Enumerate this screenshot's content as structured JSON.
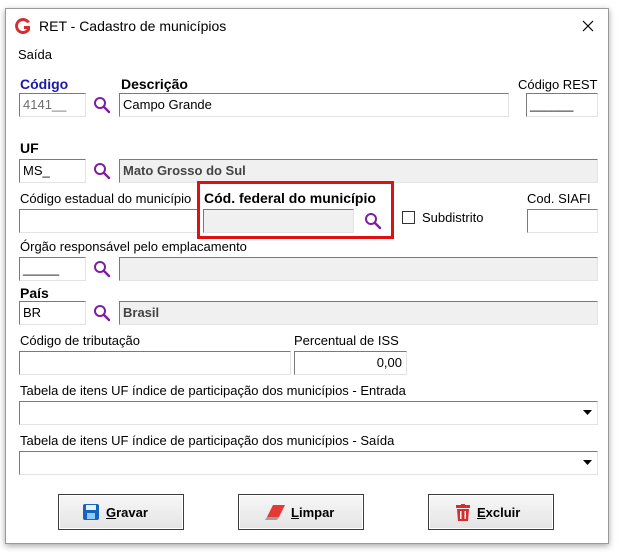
{
  "window": {
    "title": "RET - Cadastro de municípios"
  },
  "menu": {
    "items": [
      "Saída"
    ]
  },
  "labels": {
    "codigo": "Código",
    "descricao": "Descrição",
    "codigo_rest": "Código REST",
    "uf": "UF",
    "codigo_estadual": "Código estadual do município",
    "cod_federal": "Cód. federal do município",
    "subdistrito": "Subdistrito",
    "cod_siafi": "Cod. SIAFI",
    "orgao": "Órgão responsável pelo emplacamento",
    "pais": "País",
    "codigo_tributacao": "Código de tributação",
    "percentual_iss": "Percentual de ISS",
    "tabela_entrada": "Tabela de itens UF índice de participação dos municípios - Entrada",
    "tabela_saida": "Tabela de itens UF índice de participação dos municípios - Saída"
  },
  "values": {
    "codigo": "4141__",
    "descricao": "Campo Grande",
    "codigo_rest": "______",
    "uf": "MS_",
    "uf_nome": "Mato Grosso do Sul",
    "codigo_estadual": "",
    "cod_federal": "",
    "cod_siafi": "",
    "orgao": "_____",
    "orgao_nome": "",
    "pais": "BR",
    "pais_nome": "Brasil",
    "codigo_tributacao": "",
    "percentual_iss": "0,00",
    "tabela_entrada": "",
    "tabela_saida": ""
  },
  "buttons": {
    "gravar": "Gravar",
    "limpar": "Limpar",
    "excluir": "Excluir"
  },
  "colors": {
    "highlight": "#e01010",
    "label_blue": "#1a1aa6",
    "search_icon": "#7b1fa2"
  }
}
